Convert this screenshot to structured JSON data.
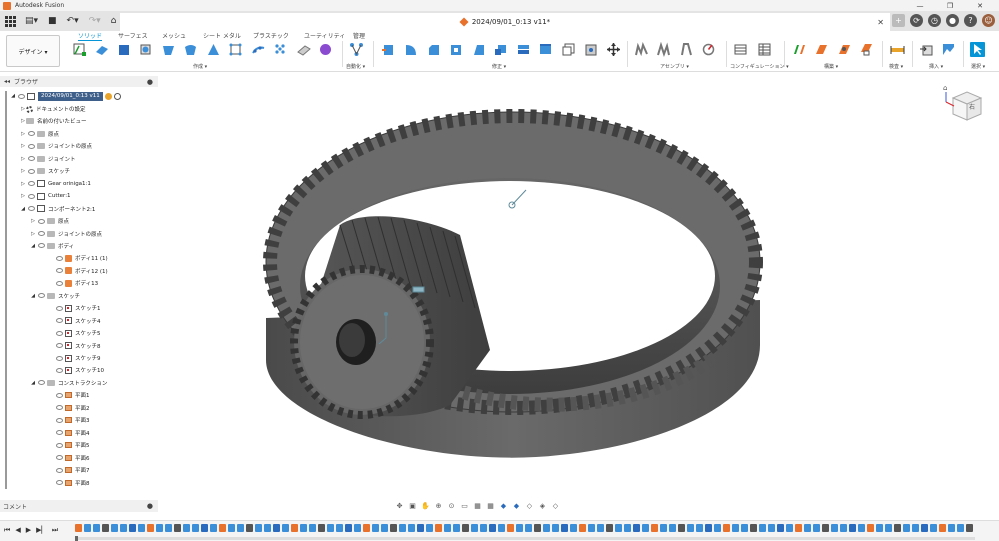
{
  "window": {
    "app_title": "Autodesk Fusion",
    "minimize": "—",
    "restore": "❐",
    "close": "✕"
  },
  "document": {
    "tab_title": "2024/09/01_0:13 v11*",
    "close": "✕"
  },
  "ribbon": {
    "workspace_button": "デザイン ▾",
    "tabs": [
      "ソリッド",
      "サーフェス",
      "メッシュ",
      "シート メタル",
      "プラスチック",
      "ユーティリティ",
      "管理"
    ],
    "active_tab": "ソリッド",
    "groups": [
      "作成 ▾",
      "自動化 ▾",
      "修正 ▾",
      "アセンブリ ▾",
      "コンフィギュレーション ▾",
      "構築 ▾",
      "検査 ▾",
      "挿入 ▾",
      "選択 ▾"
    ]
  },
  "browser": {
    "title": "ブラウザ",
    "root": "2024/09/01_0:13 v11",
    "items": [
      {
        "label": "ドキュメントの設定",
        "icon": "settings"
      },
      {
        "label": "名前の付いたビュー",
        "icon": "folder"
      },
      {
        "label": "原点",
        "icon": "folder"
      },
      {
        "label": "ジョイントの原点",
        "icon": "folder"
      },
      {
        "label": "ジョイント",
        "icon": "folder"
      },
      {
        "label": "スケッチ",
        "icon": "folder"
      },
      {
        "label": "Gear oriniga1:1",
        "icon": "component"
      },
      {
        "label": "Cutter:1",
        "icon": "component"
      },
      {
        "label": "コンポーネント2:1",
        "icon": "component"
      },
      {
        "label": "原点",
        "icon": "folder"
      },
      {
        "label": "ジョイントの原点",
        "icon": "folder"
      },
      {
        "label": "ボディ",
        "icon": "folder"
      },
      {
        "label": "ボディ11 (1)",
        "icon": "body"
      },
      {
        "label": "ボディ12 (1)",
        "icon": "body"
      },
      {
        "label": "ボディ13",
        "icon": "body"
      },
      {
        "label": "スケッチ",
        "icon": "folder"
      },
      {
        "label": "スケッチ1",
        "icon": "sketch"
      },
      {
        "label": "スケッチ4",
        "icon": "sketch"
      },
      {
        "label": "スケッチ5",
        "icon": "sketch"
      },
      {
        "label": "スケッチ8",
        "icon": "sketch"
      },
      {
        "label": "スケッチ9",
        "icon": "sketch"
      },
      {
        "label": "スケッチ10",
        "icon": "sketch"
      },
      {
        "label": "コンストラクション",
        "icon": "folder"
      },
      {
        "label": "平面1",
        "icon": "plane"
      },
      {
        "label": "平面2",
        "icon": "plane"
      },
      {
        "label": "平面3",
        "icon": "plane"
      },
      {
        "label": "平面4",
        "icon": "plane"
      },
      {
        "label": "平面5",
        "icon": "plane"
      },
      {
        "label": "平面6",
        "icon": "plane"
      },
      {
        "label": "平面7",
        "icon": "plane"
      },
      {
        "label": "平面8",
        "icon": "plane"
      }
    ]
  },
  "comments": {
    "title": "コメント"
  },
  "viewcube": {
    "face_label": "右",
    "home_icon": "home-icon"
  },
  "colors": {
    "accent": "#0696d7",
    "gear": "#5a5a5a",
    "orange": "#e8712b"
  }
}
